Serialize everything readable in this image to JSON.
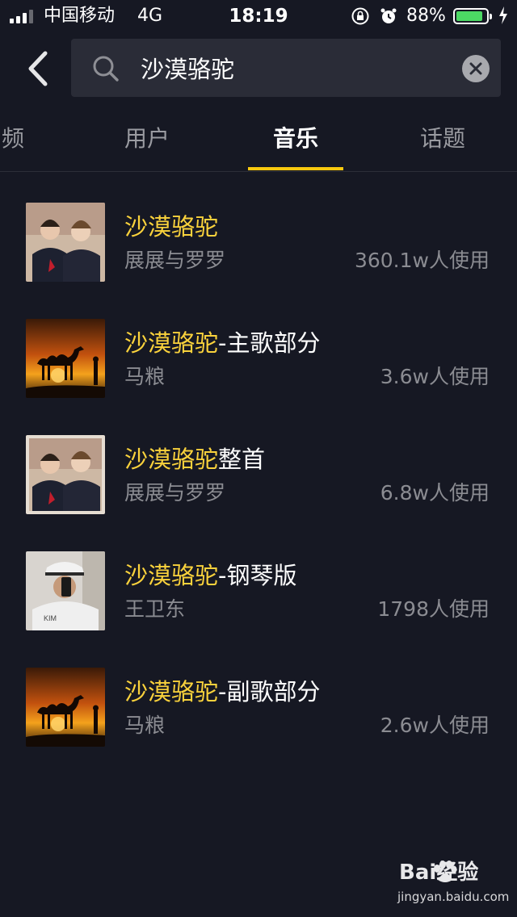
{
  "status_bar": {
    "carrier": "中国移动",
    "network": "4G",
    "time": "18:19",
    "battery_percent": "88%",
    "battery_level": 0.88,
    "icons": [
      "signal-icon",
      "rotation-lock-icon",
      "alarm-icon",
      "battery-icon",
      "charging-icon"
    ]
  },
  "search": {
    "query": "沙漠骆驼",
    "placeholder": ""
  },
  "tabs": [
    {
      "label": "频",
      "active": false
    },
    {
      "label": "用户",
      "active": false
    },
    {
      "label": "音乐",
      "active": true
    },
    {
      "label": "话题",
      "active": false
    }
  ],
  "results": [
    {
      "title_highlight": "沙漠骆驼",
      "title_rest": "",
      "artist": "展展与罗罗",
      "usage": "360.1w人使用",
      "cover": "duo-portrait"
    },
    {
      "title_highlight": "沙漠骆驼",
      "title_rest": "-主歌部分",
      "artist": "马粮",
      "usage": "3.6w人使用",
      "cover": "desert-camel"
    },
    {
      "title_highlight": "沙漠骆驼",
      "title_rest": "整首",
      "artist": "展展与罗罗",
      "usage": "6.8w人使用",
      "cover": "duo-portrait"
    },
    {
      "title_highlight": "沙漠骆驼",
      "title_rest": "-钢琴版",
      "artist": "王卫东",
      "usage": "1798人使用",
      "cover": "selfie"
    },
    {
      "title_highlight": "沙漠骆驼",
      "title_rest": "-副歌部分",
      "artist": "马粮",
      "usage": "2.6w人使用",
      "cover": "desert-camel"
    }
  ],
  "watermark": {
    "brand": "Bai经验",
    "url": "jingyan.baidu.com"
  },
  "colors": {
    "background": "#161823",
    "accent": "#f9c80e",
    "highlight_text": "#fad23c",
    "secondary_text": "#8b8c92"
  }
}
